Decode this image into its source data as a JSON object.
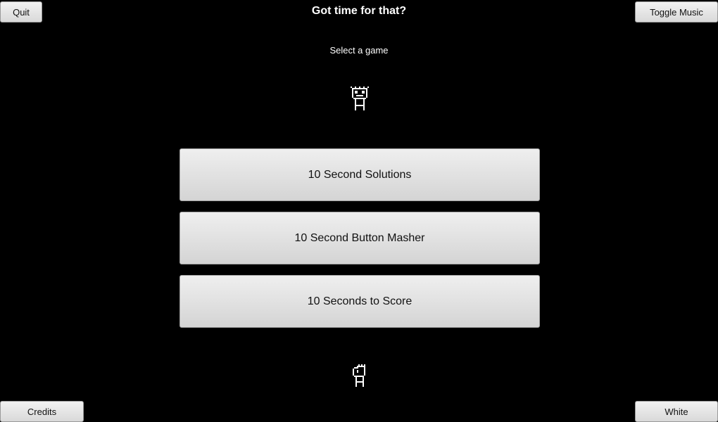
{
  "header": {
    "title": "Got time for that?",
    "subtitle": "Select a game"
  },
  "top_bar": {
    "quit_label": "Quit",
    "toggle_music_label": "Toggle Music"
  },
  "menu": {
    "games": [
      {
        "label": "10 Second Solutions"
      },
      {
        "label": "10 Second Button Masher"
      },
      {
        "label": "10 Seconds to Score"
      }
    ]
  },
  "bottom_bar": {
    "credits_label": "Credits",
    "theme_label": "White"
  },
  "sprites": {
    "top": "pixel-character-icon",
    "bottom": "pixel-character-icon"
  },
  "colors": {
    "background": "#000000",
    "text": "#ffffff",
    "button": "#e6e6e6"
  }
}
